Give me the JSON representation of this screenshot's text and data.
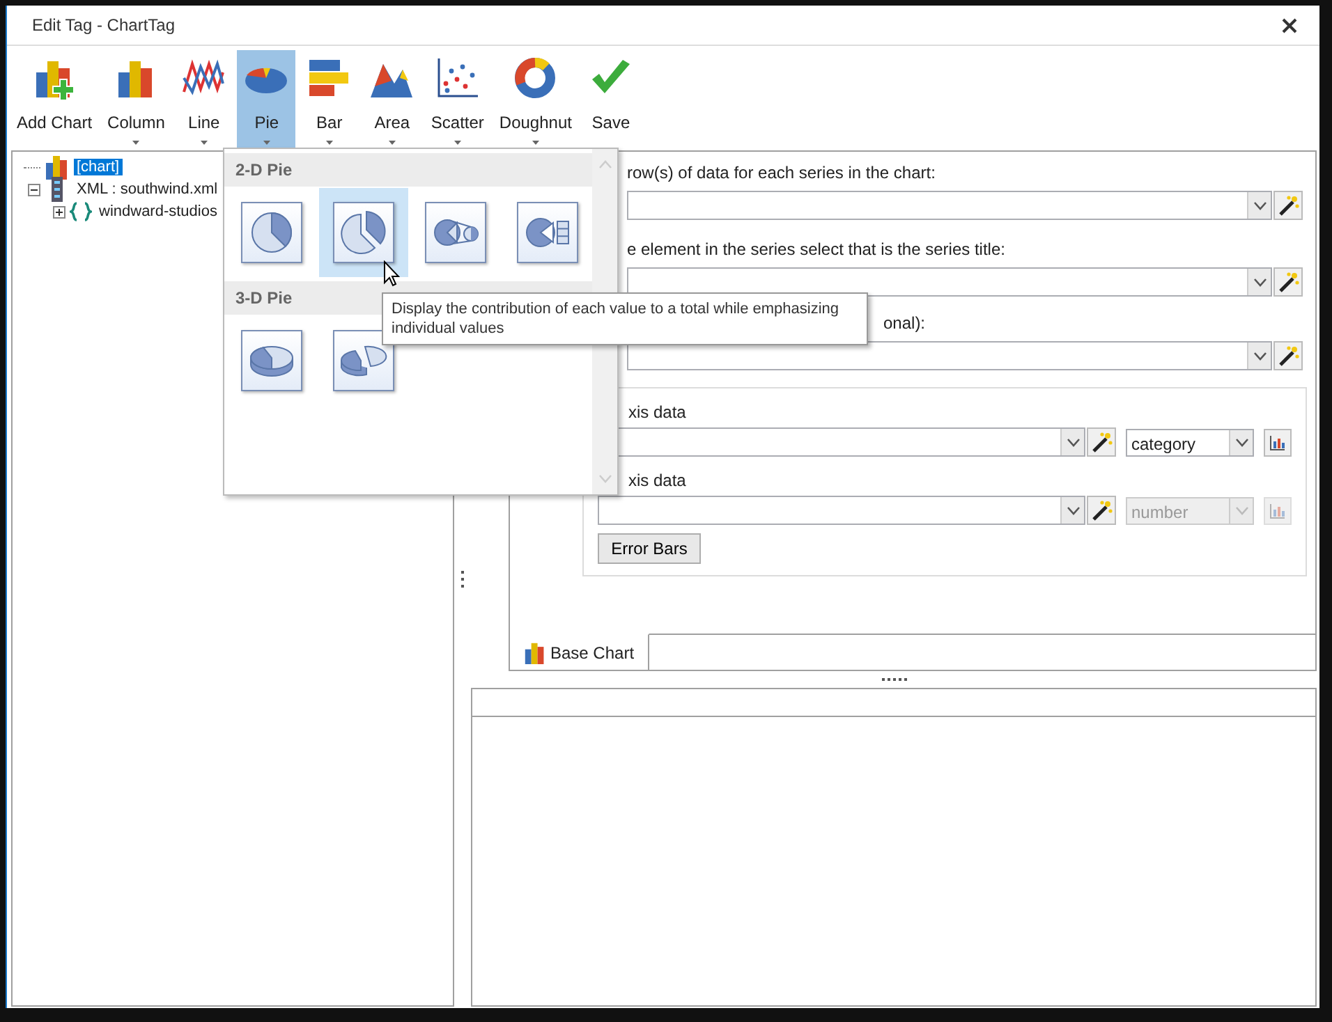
{
  "window": {
    "title": "Edit Tag - ChartTag"
  },
  "toolbar": [
    {
      "label": "Add Chart",
      "kind": "button",
      "selected": false
    },
    {
      "label": "Column",
      "kind": "dropdown",
      "selected": false
    },
    {
      "label": "Line",
      "kind": "dropdown",
      "selected": false
    },
    {
      "label": "Pie",
      "kind": "dropdown",
      "selected": true
    },
    {
      "label": "Bar",
      "kind": "dropdown",
      "selected": false
    },
    {
      "label": "Area",
      "kind": "dropdown",
      "selected": false
    },
    {
      "label": "Scatter",
      "kind": "dropdown",
      "selected": false
    },
    {
      "label": "Doughnut",
      "kind": "dropdown",
      "selected": false
    },
    {
      "label": "Save",
      "kind": "button",
      "selected": false
    }
  ],
  "tree": [
    {
      "label": "[chart]",
      "kind": "chart",
      "selected": true
    },
    {
      "label": "XML : southwind.xml",
      "kind": "xml",
      "selected": false,
      "expanded": true,
      "children": [
        {
          "label": "windward-studios",
          "kind": "node",
          "selected": false,
          "expanded": false
        }
      ]
    }
  ],
  "form": {
    "fields": [
      {
        "label": "row(s) of data for each series in the chart:"
      },
      {
        "label": "e element in the series select that is the series title:"
      },
      {
        "label": "onal):"
      }
    ],
    "axes": [
      {
        "label": "xis data",
        "type": "category",
        "disabled": false
      },
      {
        "label": "xis data",
        "type": "number",
        "disabled": true
      }
    ],
    "error_bars_button": "Error Bars",
    "tabs": [
      {
        "label": "Base Chart",
        "selected": true
      }
    ]
  },
  "pie_menu": {
    "sections": [
      {
        "title": "2-D Pie",
        "items": [
          {
            "kind": "pie",
            "selected": false
          },
          {
            "kind": "exploded",
            "selected": true
          },
          {
            "kind": "pie-of-pie",
            "selected": false
          },
          {
            "kind": "bar-of-pie",
            "selected": false
          }
        ]
      },
      {
        "title": "3-D Pie",
        "items": [
          {
            "kind": "pie-3d",
            "selected": false
          },
          {
            "kind": "exploded-3d",
            "selected": false
          }
        ]
      }
    ],
    "tooltip": "Display the contribution of each value to a total while emphasizing individual values"
  }
}
